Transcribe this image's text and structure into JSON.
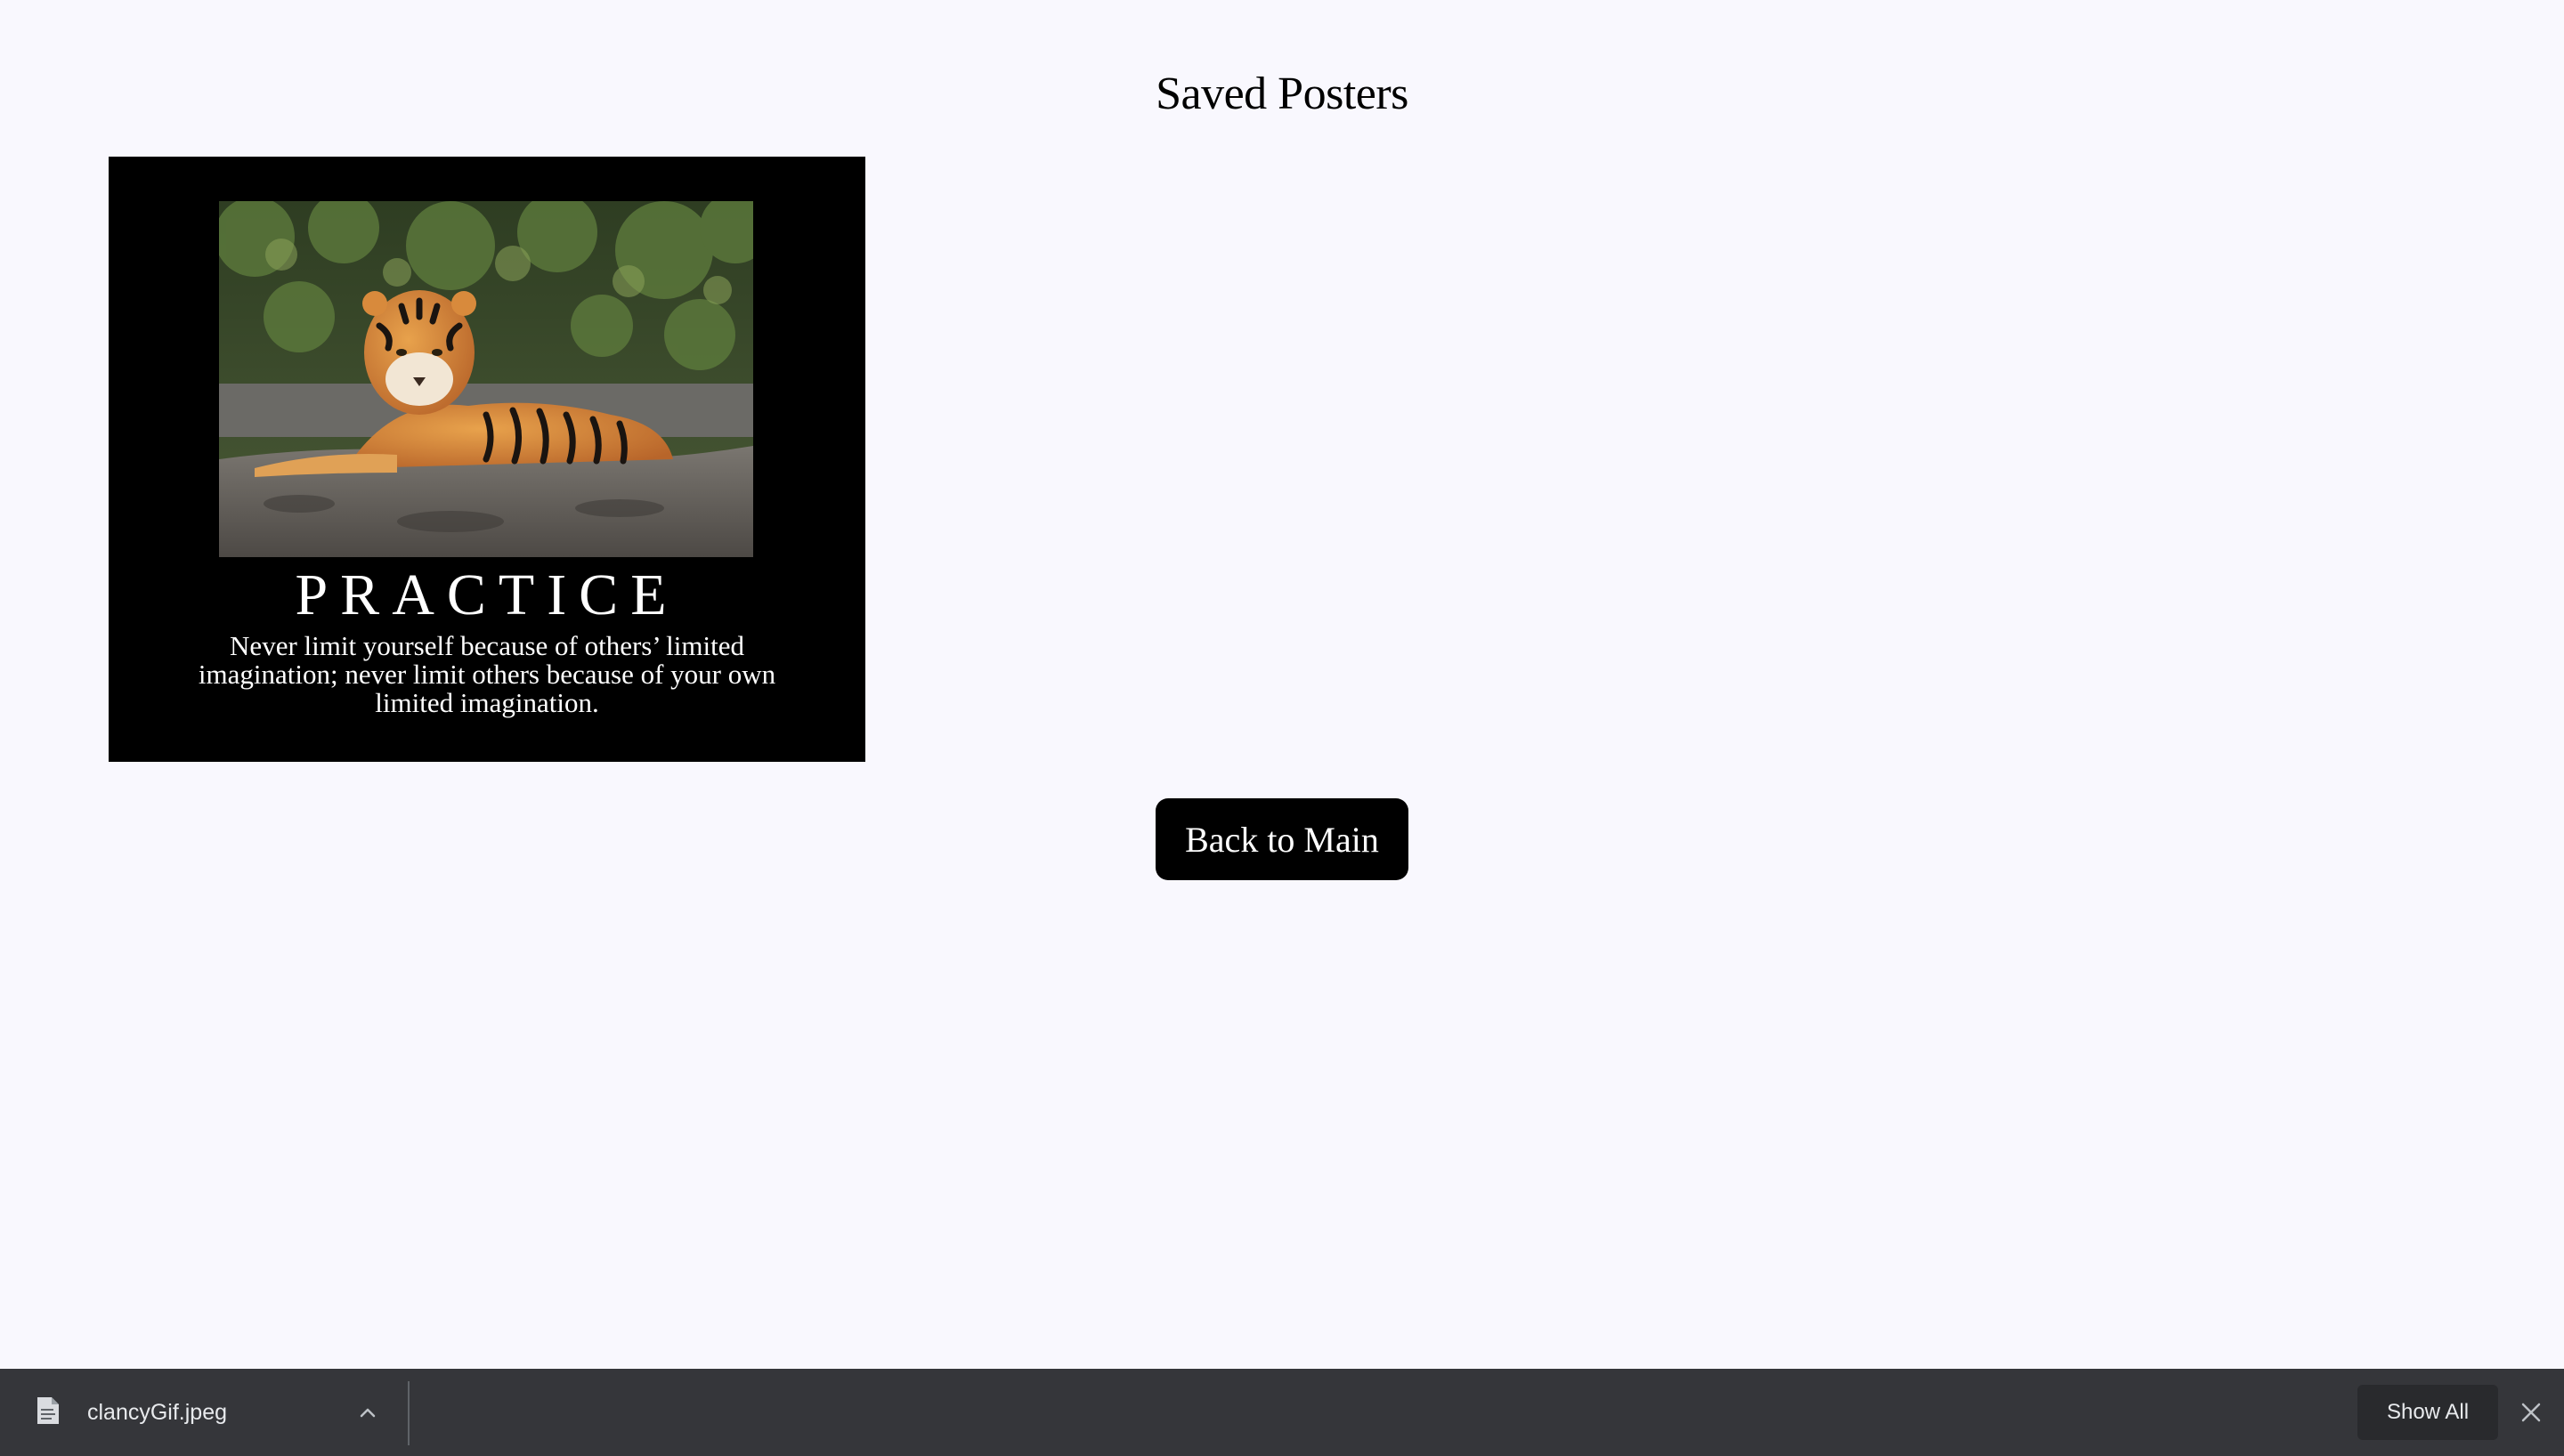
{
  "page": {
    "title": "Saved Posters"
  },
  "posters": [
    {
      "image": "tiger-photo",
      "title": "PRACTICE",
      "quote": "Never limit yourself because of others’ limited imagination; never limit others because of your own limited imagination."
    }
  ],
  "actions": {
    "back_label": "Back to Main"
  },
  "download_bar": {
    "file_icon": "file-icon",
    "file_name": "clancyGif.jpeg",
    "show_all_label": "Show All",
    "expand_icon": "chevron-up-icon",
    "close_icon": "close-icon"
  },
  "colors": {
    "page_background": "#f9f8fe",
    "poster_background": "#000000",
    "button_background": "#000000",
    "download_bar": "#35363a"
  }
}
